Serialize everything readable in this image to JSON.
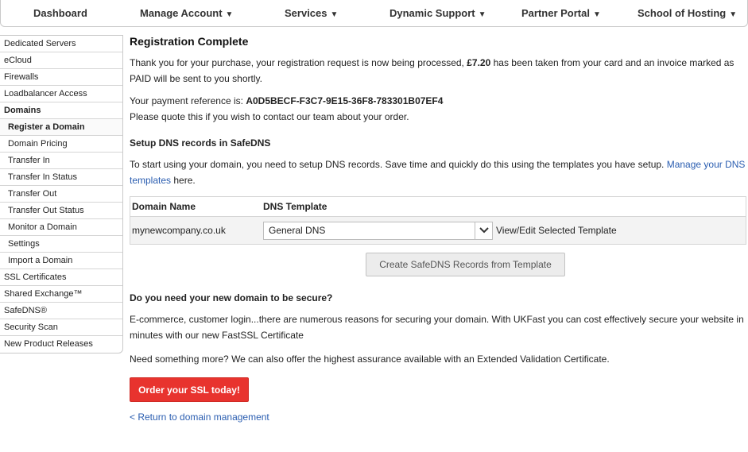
{
  "nav": {
    "items": [
      {
        "label": "Dashboard",
        "dropdown": false
      },
      {
        "label": "Manage Account",
        "dropdown": true
      },
      {
        "label": "Services",
        "dropdown": true
      },
      {
        "label": "Dynamic Support",
        "dropdown": true
      },
      {
        "label": "Partner Portal",
        "dropdown": true
      },
      {
        "label": "School of Hosting",
        "dropdown": true
      }
    ]
  },
  "sidebar": {
    "items": [
      {
        "label": "Dedicated Servers"
      },
      {
        "label": "eCloud"
      },
      {
        "label": "Firewalls"
      },
      {
        "label": "Loadbalancer Access"
      },
      {
        "label": "Domains"
      },
      {
        "label": "Register a Domain"
      },
      {
        "label": "Domain Pricing"
      },
      {
        "label": "Transfer In"
      },
      {
        "label": "Transfer In Status"
      },
      {
        "label": "Transfer Out"
      },
      {
        "label": "Transfer Out Status"
      },
      {
        "label": "Monitor a Domain"
      },
      {
        "label": "Settings"
      },
      {
        "label": "Import a Domain"
      },
      {
        "label": "SSL Certificates"
      },
      {
        "label": "Shared Exchange™"
      },
      {
        "label": "SafeDNS®"
      },
      {
        "label": "Security Scan"
      },
      {
        "label": "New Product Releases"
      }
    ]
  },
  "main": {
    "title": "Registration Complete",
    "purchase_text_1": "Thank you for your purchase, your registration request is now being processed, ",
    "amount": "£7.20",
    "purchase_text_2": " has been taken from your card and an invoice marked as PAID will be sent to you shortly.",
    "payment_ref_label": "Your payment reference is: ",
    "payment_ref_value": "A0D5BECF-F3C7-9E15-36F8-783301B07EF4",
    "quote_text": "Please quote this if you wish to contact our team about your order.",
    "dns_heading": "Setup DNS records in SafeDNS",
    "dns_intro_text": "To start using your domain, you need to setup DNS records. Save time and quickly do this using the templates you have setup. ",
    "dns_intro_link": "Manage your DNS templates",
    "dns_intro_suffix": " here.",
    "dns_table": {
      "col_domain": "Domain Name",
      "col_template": "DNS Template",
      "domain": "mynewcompany.co.uk",
      "selected_template": "General DNS",
      "view_edit_label": "View/Edit Selected Template"
    },
    "create_button": "Create SafeDNS Records from Template",
    "secure_heading": "Do you need your new domain to be secure?",
    "secure_text": "E-commerce, customer login...there are numerous reasons for securing your domain. With UKFast you can cost effectively secure your website in minutes with our new FastSSL Certificate",
    "more_text": "Need something more? We can also offer the highest assurance available with an Extended Validation Certificate.",
    "ssl_button": "Order your SSL today!",
    "return_link": "< Return to domain management"
  },
  "colors": {
    "accent_red": "#e8332e",
    "link_blue": "#2a5db0"
  }
}
